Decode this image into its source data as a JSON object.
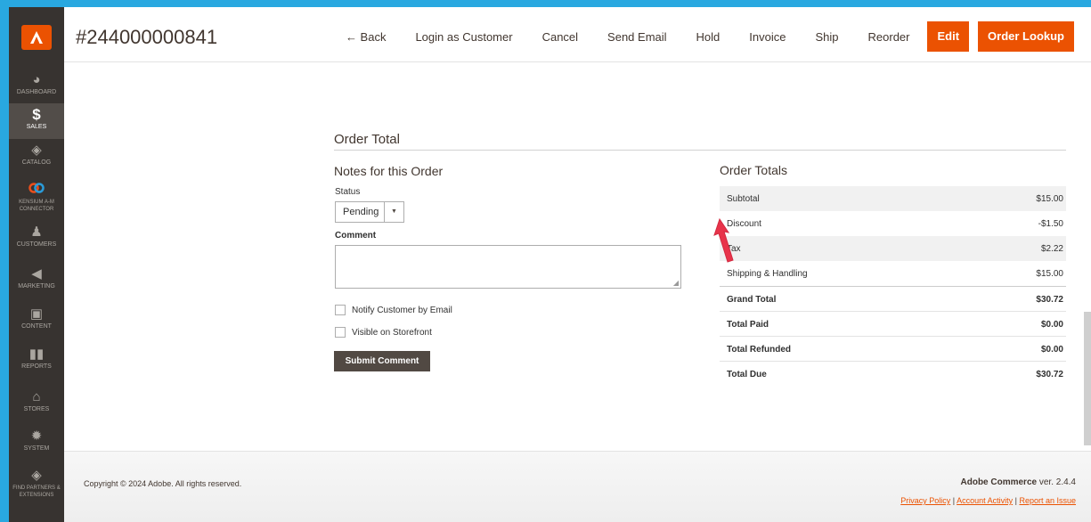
{
  "header": {
    "order_id": "#244000000841",
    "actions": [
      "← Back",
      "Login as Customer",
      "Cancel",
      "Send Email",
      "Hold",
      "Invoice",
      "Ship",
      "Reorder"
    ],
    "edit_label": "Edit",
    "lookup_label": "Order Lookup"
  },
  "sidebar": {
    "items": [
      {
        "label": "DASHBOARD",
        "icon": "dashboard-icon"
      },
      {
        "label": "SALES",
        "icon": "dollar-icon"
      },
      {
        "label": "CATALOG",
        "icon": "cube-icon"
      },
      {
        "label": "KENSIUM A-M CONNECTOR",
        "icon": "connector-icon"
      },
      {
        "label": "CUSTOMERS",
        "icon": "person-icon"
      },
      {
        "label": "MARKETING",
        "icon": "megaphone-icon"
      },
      {
        "label": "CONTENT",
        "icon": "layout-icon"
      },
      {
        "label": "REPORTS",
        "icon": "bar-chart-icon"
      },
      {
        "label": "STORES",
        "icon": "store-icon"
      },
      {
        "label": "SYSTEM",
        "icon": "gear-icon"
      },
      {
        "label": "FIND PARTNERS & EXTENSIONS",
        "icon": "box-icon"
      }
    ]
  },
  "order_total": {
    "title": "Order Total",
    "notes_title": "Notes for this Order",
    "status_label": "Status",
    "status_value": "Pending",
    "comment_label": "Comment",
    "comment_value": "",
    "notify_label": "Notify Customer by Email",
    "visible_label": "Visible on Storefront",
    "submit_label": "Submit Comment",
    "totals_title": "Order Totals",
    "rows": [
      {
        "label": "Subtotal",
        "amount": "$15.00"
      },
      {
        "label": "Discount",
        "amount": "-$1.50"
      },
      {
        "label": "Tax",
        "amount": "$2.22"
      },
      {
        "label": "Shipping & Handling",
        "amount": "$15.00"
      }
    ],
    "bold_rows": [
      {
        "label": "Grand Total",
        "amount": "$30.72"
      },
      {
        "label": "Total Paid",
        "amount": "$0.00"
      },
      {
        "label": "Total Refunded",
        "amount": "$0.00"
      },
      {
        "label": "Total Due",
        "amount": "$30.72"
      }
    ]
  },
  "footer": {
    "copyright": "Copyright © 2024 Adobe. All rights reserved.",
    "brand": "Adobe Commerce",
    "version": " ver. 2.4.4",
    "links": [
      "Privacy Policy",
      "Account Activity",
      "Report an Issue"
    ]
  },
  "colors": {
    "accent": "#eb5202",
    "sidebar": "#373330",
    "frame": "#29a8e0",
    "annotation_arrow": "#e8334a"
  }
}
